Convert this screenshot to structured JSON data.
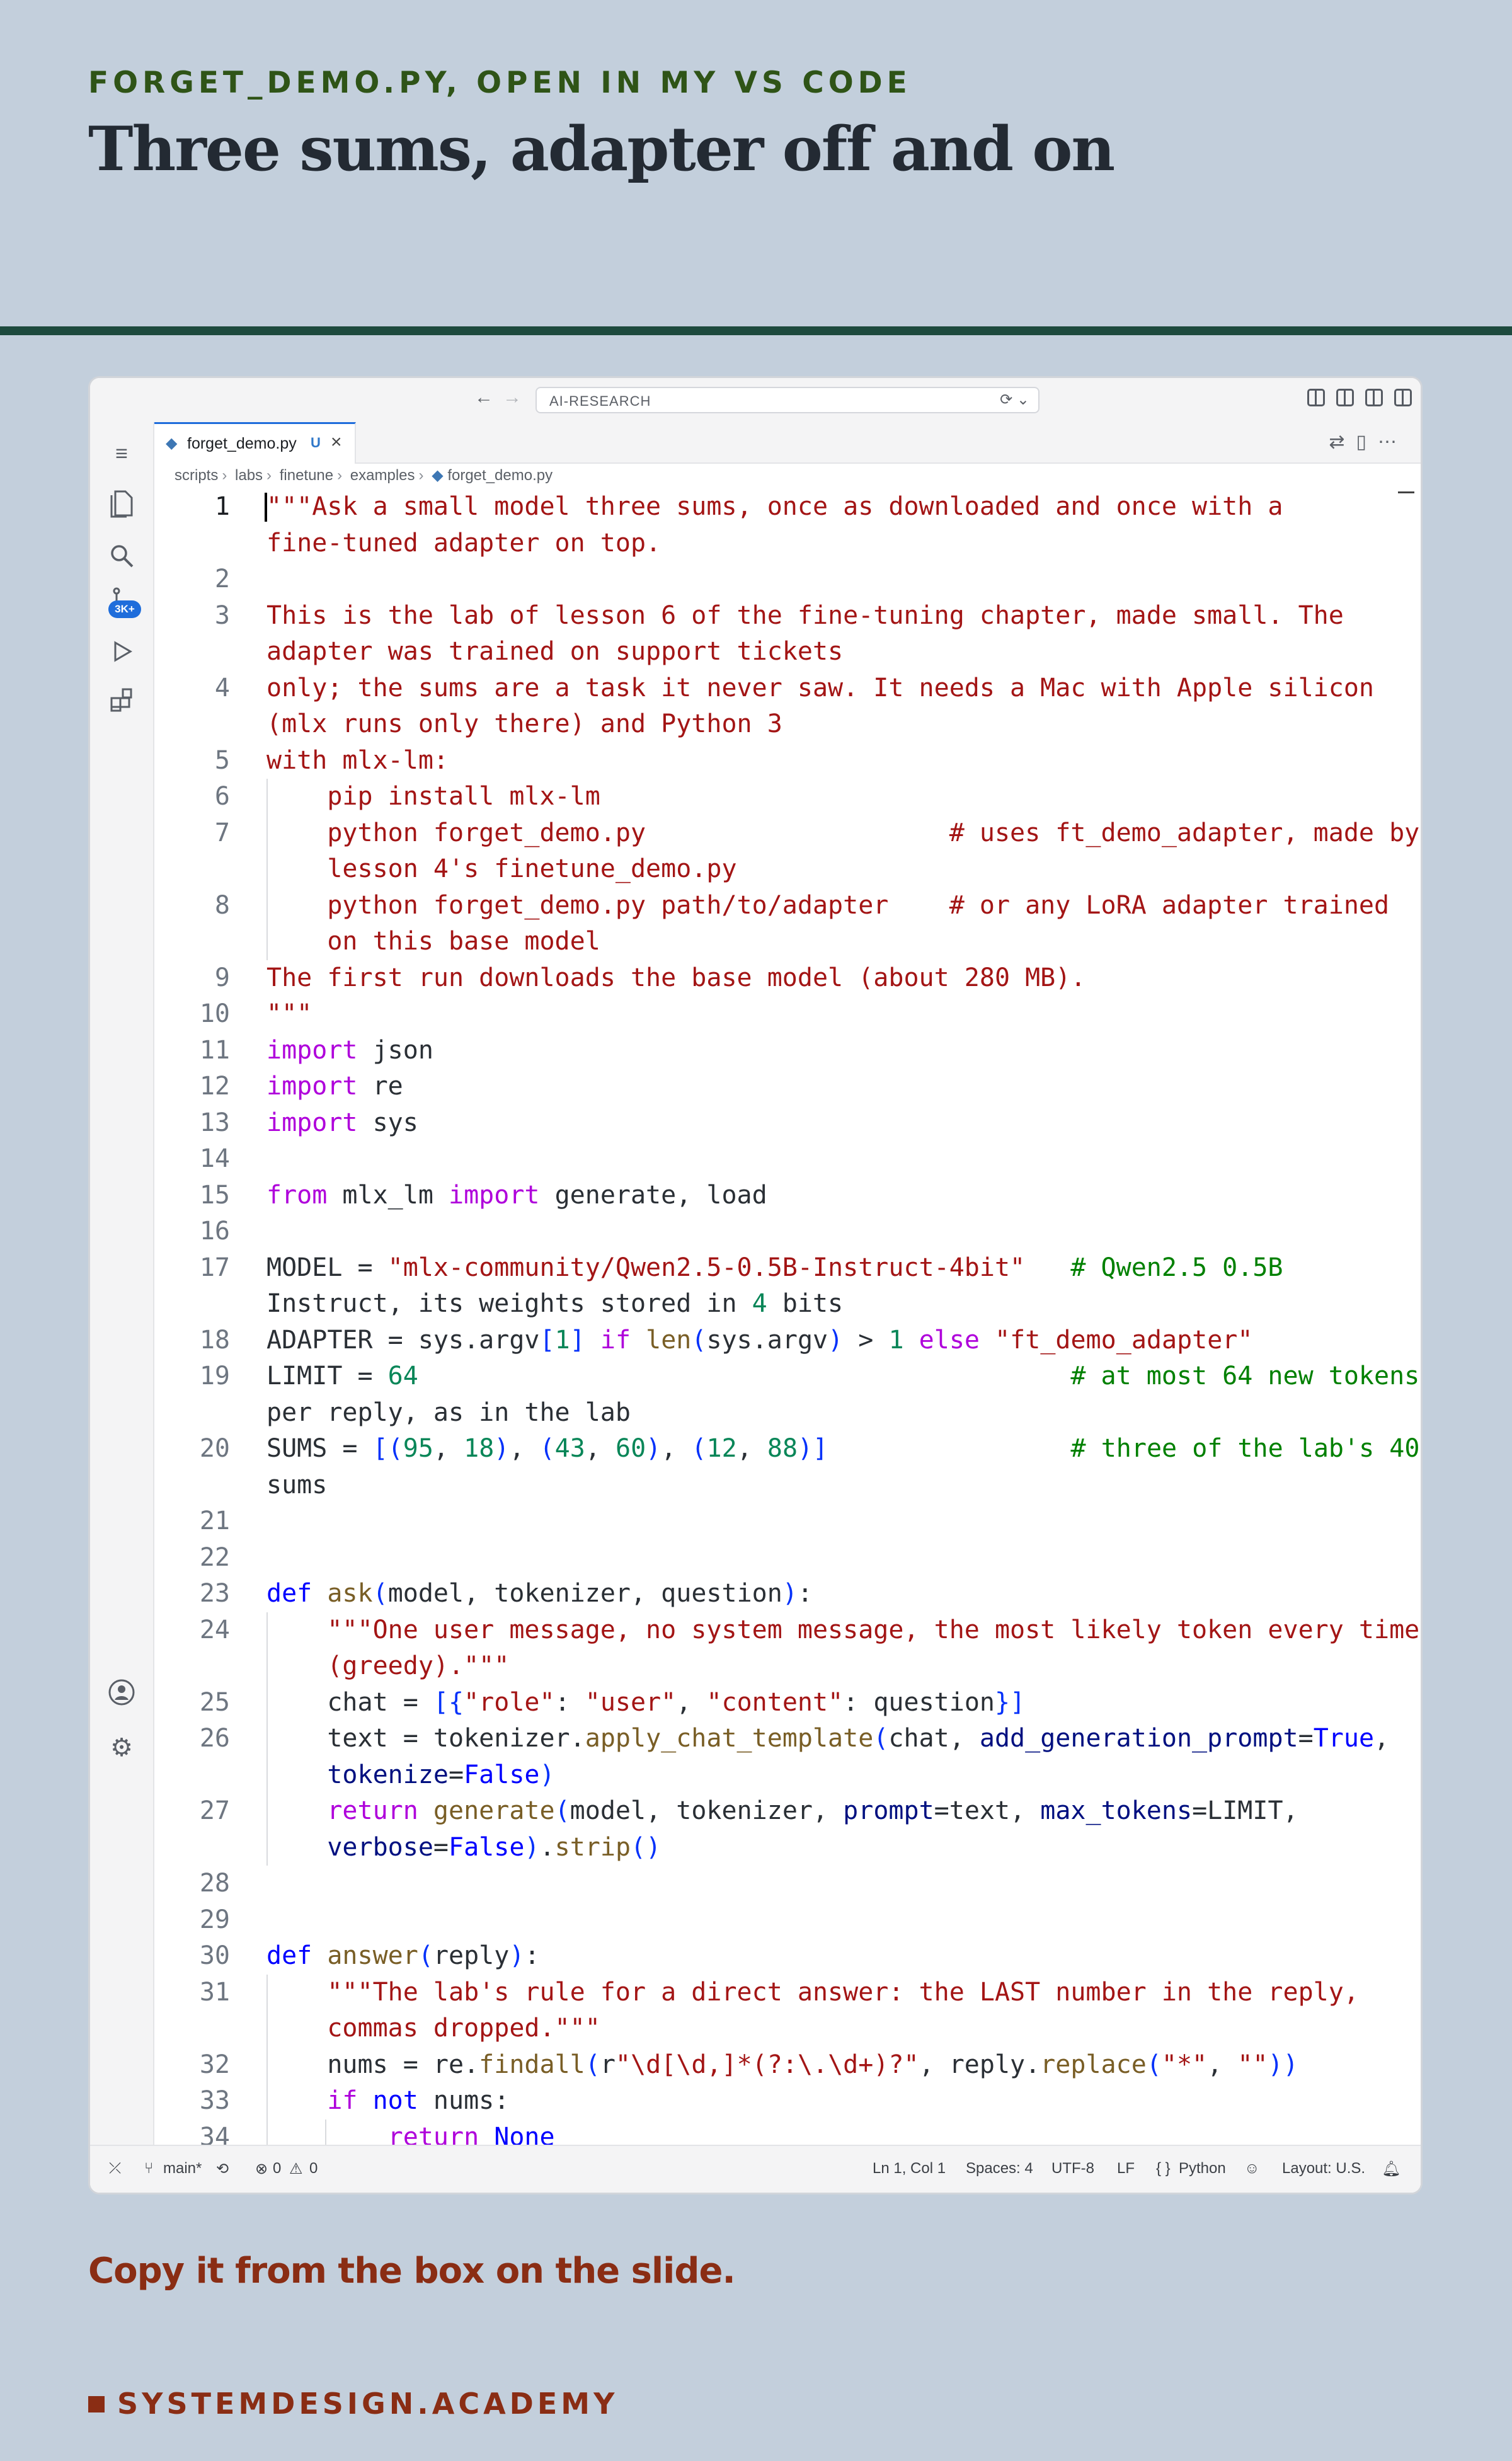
{
  "slide": {
    "eyebrow": "FORGET_DEMO.PY, OPEN IN MY VS CODE",
    "title": "Three sums, adapter off and on",
    "caption": "Copy it from the box on the slide.",
    "brand": "SYSTEMDESIGN.ACADEMY"
  },
  "vscode": {
    "search_label": "AI-RESEARCH",
    "tab": {
      "file": "forget_demo.py",
      "status": "U"
    },
    "badge": "3K+",
    "breadcrumbs": [
      "scripts",
      "labs",
      "finetune",
      "examples",
      "forget_demo.py"
    ],
    "status": {
      "branch": "main*",
      "errors": "0",
      "warnings": "0",
      "position": "Ln 1, Col 1",
      "spaces": "Spaces: 4",
      "encoding": "UTF-8",
      "eol": "LF",
      "language": "Python",
      "layout": "Layout: U.S."
    }
  },
  "code": [
    {
      "n": "1",
      "t": "\"\"\"Ask a small model three sums, once as downloaded and once with a"
    },
    {
      "n": "",
      "t": "fine-tuned adapter on top."
    },
    {
      "n": "2",
      "t": ""
    },
    {
      "n": "3",
      "t": "This is the lab of lesson 6 of the fine-tuning chapter, made small. The"
    },
    {
      "n": "",
      "t": "adapter was trained on support tickets"
    },
    {
      "n": "4",
      "t": "only; the sums are a task it never saw. It needs a Mac with Apple silicon"
    },
    {
      "n": "",
      "t": "(mlx runs only there) and Python 3"
    },
    {
      "n": "5",
      "t": "with mlx-lm:"
    },
    {
      "n": "6",
      "t": "    pip install mlx-lm"
    },
    {
      "n": "7",
      "t": "    python forget_demo.py                    # uses ft_demo_adapter, made by"
    },
    {
      "n": "",
      "t": "    lesson 4's finetune_demo.py"
    },
    {
      "n": "8",
      "t": "    python forget_demo.py path/to/adapter    # or any LoRA adapter trained"
    },
    {
      "n": "",
      "t": "    on this base model"
    },
    {
      "n": "9",
      "t": "The first run downloads the base model (about 280 MB)."
    },
    {
      "n": "10",
      "t": "\"\"\""
    },
    {
      "n": "11",
      "t": "import json"
    },
    {
      "n": "12",
      "t": "import re"
    },
    {
      "n": "13",
      "t": "import sys"
    },
    {
      "n": "14",
      "t": ""
    },
    {
      "n": "15",
      "t": "from mlx_lm import generate, load"
    },
    {
      "n": "16",
      "t": ""
    },
    {
      "n": "17",
      "t": "MODEL = \"mlx-community/Qwen2.5-0.5B-Instruct-4bit\"   # Qwen2.5 0.5B"
    },
    {
      "n": "",
      "t": "Instruct, its weights stored in 4 bits"
    },
    {
      "n": "18",
      "t": "ADAPTER = sys.argv[1] if len(sys.argv) > 1 else \"ft_demo_adapter\""
    },
    {
      "n": "19",
      "t": "LIMIT = 64                                           # at most 64 new tokens"
    },
    {
      "n": "",
      "t": "per reply, as in the lab"
    },
    {
      "n": "20",
      "t": "SUMS = [(95, 18), (43, 60), (12, 88)]                # three of the lab's 40"
    },
    {
      "n": "",
      "t": "sums"
    },
    {
      "n": "21",
      "t": ""
    },
    {
      "n": "22",
      "t": ""
    },
    {
      "n": "23",
      "t": "def ask(model, tokenizer, question):"
    },
    {
      "n": "24",
      "t": "    \"\"\"One user message, no system message, the most likely token every time"
    },
    {
      "n": "",
      "t": "    (greedy).\"\"\""
    },
    {
      "n": "25",
      "t": "    chat = [{\"role\": \"user\", \"content\": question}]"
    },
    {
      "n": "26",
      "t": "    text = tokenizer.apply_chat_template(chat, add_generation_prompt=True,"
    },
    {
      "n": "",
      "t": "    tokenize=False)"
    },
    {
      "n": "27",
      "t": "    return generate(model, tokenizer, prompt=text, max_tokens=LIMIT,"
    },
    {
      "n": "",
      "t": "    verbose=False).strip()"
    },
    {
      "n": "28",
      "t": ""
    },
    {
      "n": "29",
      "t": ""
    },
    {
      "n": "30",
      "t": "def answer(reply):"
    },
    {
      "n": "31",
      "t": "    \"\"\"The lab's rule for a direct answer: the LAST number in the reply,"
    },
    {
      "n": "",
      "t": "    commas dropped.\"\"\""
    },
    {
      "n": "32",
      "t": "    nums = re.findall(r\"\\d[\\d,]*(?:\\.\\d+)?\", reply.replace(\"*\", \"\"))"
    },
    {
      "n": "33",
      "t": "    if not nums:"
    },
    {
      "n": "34",
      "t": "        return None"
    }
  ]
}
